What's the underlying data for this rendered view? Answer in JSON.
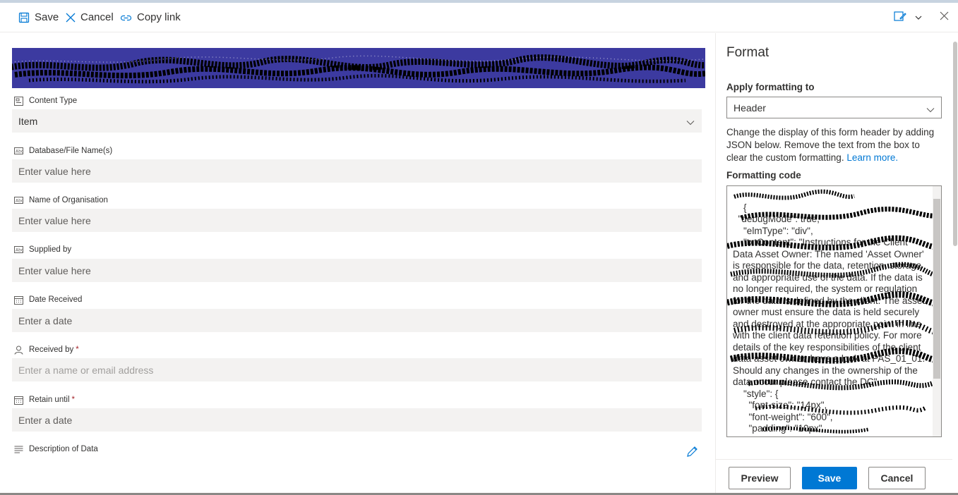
{
  "toolbar": {
    "save_label": "Save",
    "cancel_label": "Cancel",
    "copy_link_label": "Copy link"
  },
  "form": {
    "fields": [
      {
        "label": "Content Type",
        "value": "Item",
        "icon": "content-type-icon",
        "required": false
      },
      {
        "label": "Database/File Name(s)",
        "placeholder": "Enter value here",
        "icon": "text-field-icon",
        "required": false
      },
      {
        "label": "Name of Organisation",
        "placeholder": "Enter value here",
        "icon": "text-field-icon",
        "required": false
      },
      {
        "label": "Supplied by",
        "placeholder": "Enter value here",
        "icon": "text-field-icon",
        "required": false
      },
      {
        "label": "Date Received",
        "placeholder": "Enter a date",
        "icon": "calendar-icon",
        "required": false
      },
      {
        "label": "Received by",
        "placeholder": "Enter a name or email address",
        "icon": "person-icon",
        "required": true,
        "required_mark": "*"
      },
      {
        "label": "Retain until",
        "placeholder": "Enter a date",
        "icon": "calendar-icon",
        "required": true,
        "required_mark": "*"
      },
      {
        "label": "Description of Data",
        "icon": "multiline-text-icon",
        "required": false
      }
    ]
  },
  "panel": {
    "title": "Format",
    "apply_label": "Apply formatting to",
    "apply_value": "Header",
    "description": "Change the display of this form header by adding JSON below. Remove the text from the box to clear the custom formatting.",
    "learn_more": "Learn more.",
    "code_label": "Formatting code",
    "code_text": "{\n  \"debugMode\": true,\n    \"elmType\": \"div\",\n    \"txtContent\": \"Instructions for the Client Data Asset Owner: The named 'Asset Owner' is responsible for the data, retention, storage and appropriate use of the data. If the data is no longer required, the system or regulation for the data is defined by the client. The asset owner must ensure the data is held securely and destroyed at the appropriate point in line with the client data retention policy. For more details of the key responsibilities of the client data asset owner, have a look at PAS_01_01. Should any changes in the ownership of the data occur please contact the DC\",\n    \"style\": {\n      \"font-size\": \"14px\",\n      \"font-weight\": \"600\",\n      \"padding\": \"10px\"",
    "buttons": {
      "preview": "Preview",
      "save": "Save",
      "cancel": "Cancel"
    }
  },
  "colors": {
    "accent": "#0078d4",
    "header_banner": "#3c3aa0",
    "field_bg": "#f3f2f1",
    "required": "#a4262c"
  }
}
